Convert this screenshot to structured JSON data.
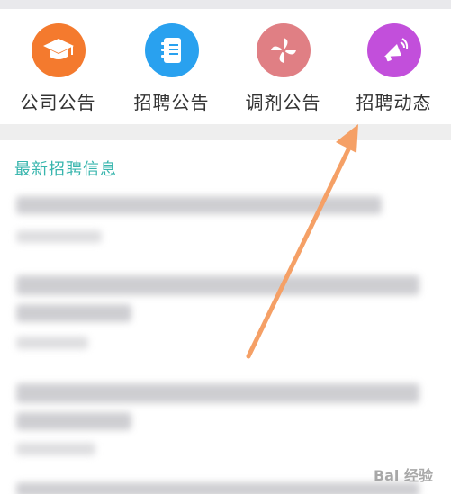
{
  "nav": {
    "items": [
      {
        "label": "公司公告",
        "icon": "graduation-cap-icon",
        "color": "#f47a2e"
      },
      {
        "label": "招聘公告",
        "icon": "notebook-icon",
        "color": "#29a1ef"
      },
      {
        "label": "调剂公告",
        "icon": "pinwheel-icon",
        "color": "#e07f84"
      },
      {
        "label": "招聘动态",
        "icon": "megaphone-icon",
        "color": "#c24fdb"
      }
    ]
  },
  "section": {
    "title": "最新招聘信息"
  },
  "watermark": {
    "text": "Bai 经验"
  },
  "colors": {
    "accent": "#37b5ad",
    "arrow": "#f5a066"
  }
}
